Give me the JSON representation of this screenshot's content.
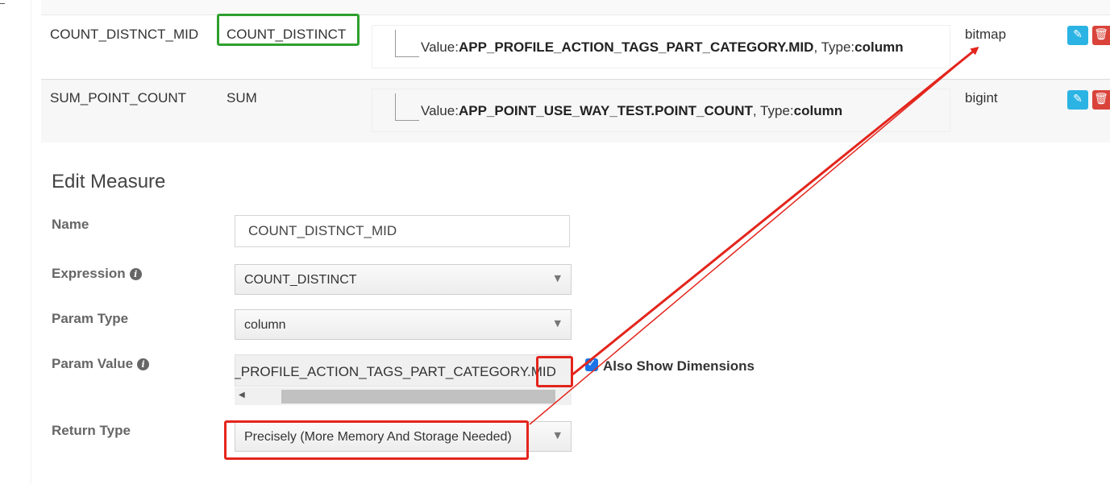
{
  "measures_table": {
    "rows": [
      {
        "name": "COUNT_DISTNCT_MID",
        "expression": "COUNT_DISTINCT",
        "param_prefix_value": "Value:",
        "param_value": "APP_PROFILE_ACTION_TAGS_PART_CATEGORY.MID",
        "param_prefix_type": ", Type:",
        "param_type": "column",
        "return_type": "bitmap"
      },
      {
        "name": "SUM_POINT_COUNT",
        "expression": "SUM",
        "param_prefix_value": "Value:",
        "param_value": "APP_POINT_USE_WAY_TEST.POINT_COUNT",
        "param_prefix_type": ", Type:",
        "param_type": "column",
        "return_type": "bigint"
      }
    ],
    "action_icons": [
      "pencil-icon",
      "trash-icon"
    ],
    "edit_button_color": "#2bb3e3",
    "delete_button_color": "#d9433a"
  },
  "edit_measure": {
    "title": "Edit Measure",
    "name_label": "Name",
    "name_value": "COUNT_DISTNCT_MID",
    "expression_label": "Expression",
    "expression_value": "COUNT_DISTINCT",
    "param_type_label": "Param Type",
    "param_type_value": "column",
    "param_value_label": "Param Value",
    "param_value_visible": "P_PROFILE_ACTION_TAGS_PART_CATEGORY.MID",
    "also_show_dimensions_label": "Also Show Dimensions",
    "also_show_dimensions_checked": true,
    "return_type_label": "Return Type",
    "return_type_value": "Precisely (More Memory And Storage Needed)"
  },
  "annotation_colors": {
    "green": "#2ea02e",
    "red": "#e3251c"
  }
}
